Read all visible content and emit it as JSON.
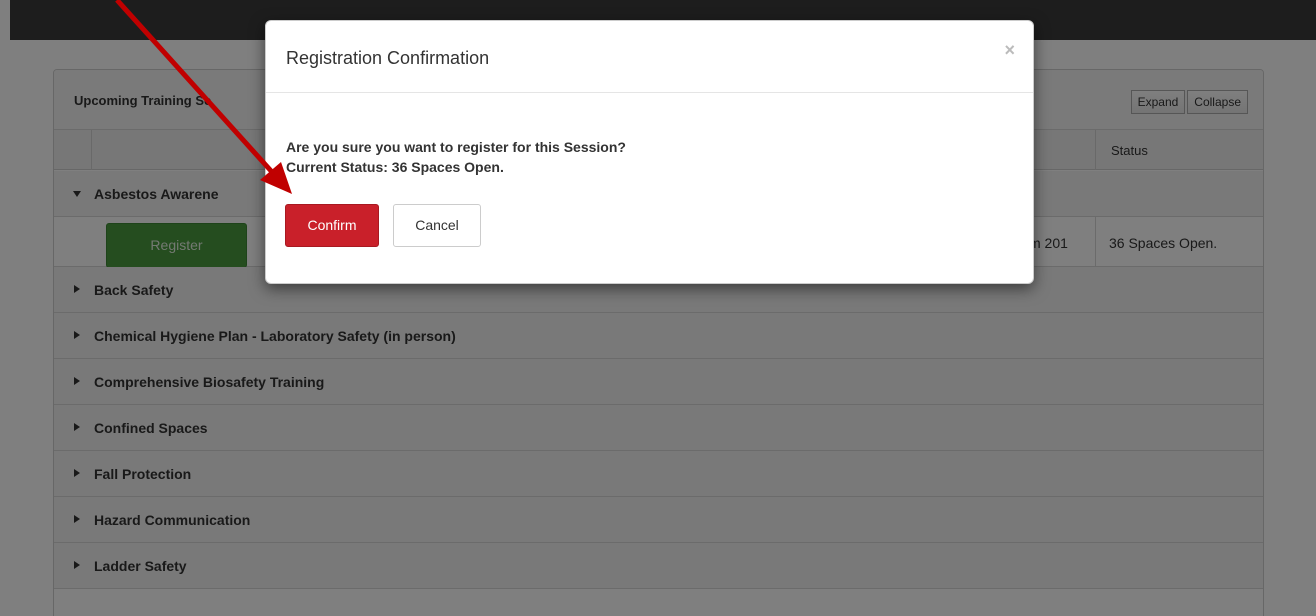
{
  "panel": {
    "title": "Upcoming Training Se",
    "expand_label": "Expand",
    "collapse_label": "Collapse",
    "status_header": "Status"
  },
  "groups": [
    {
      "label": "Asbestos Awarene",
      "expanded": true
    },
    {
      "label": "Back Safety",
      "expanded": false
    },
    {
      "label": "Chemical Hygiene Plan - Laboratory Safety (in person)",
      "expanded": false
    },
    {
      "label": "Comprehensive Biosafety Training",
      "expanded": false
    },
    {
      "label": "Confined Spaces",
      "expanded": false
    },
    {
      "label": "Fall Protection",
      "expanded": false
    },
    {
      "label": "Hazard Communication",
      "expanded": false
    },
    {
      "label": "Ladder Safety",
      "expanded": false
    }
  ],
  "session_row": {
    "register_label": "Register",
    "room_fragment": "m 201",
    "status": "36 Spaces Open."
  },
  "modal": {
    "title": "Registration Confirmation",
    "close_glyph": "×",
    "question": "Are you sure you want to register for this Session?",
    "status_line": "Current Status: 36 Spaces Open.",
    "confirm_label": "Confirm",
    "cancel_label": "Cancel"
  },
  "colors": {
    "confirm": "#c9202a",
    "register": "#4a9a3f",
    "annotation_arrow": "#c00000"
  }
}
